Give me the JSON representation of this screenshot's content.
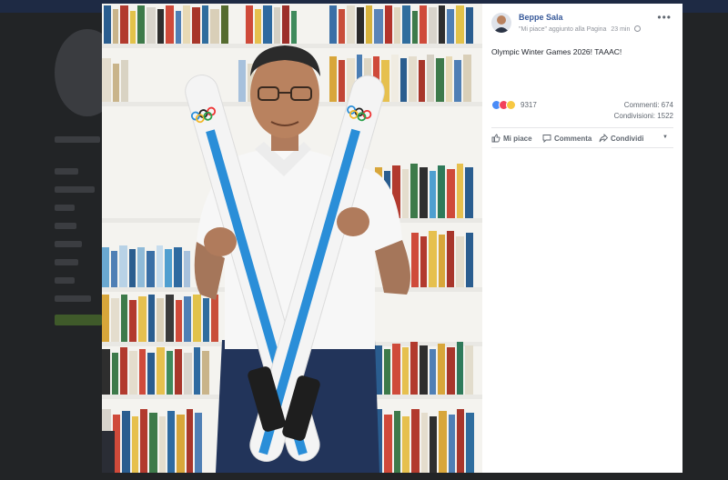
{
  "post": {
    "author": "Beppe Sala",
    "subtitle": "\"Mi piace\" aggiunto alla Pagina",
    "time": "23 min",
    "text": "Olympic Winter Games 2026! TAAAC!",
    "reactions_count": "9317",
    "comments": "Commenti: 674",
    "shares": "Condivisioni: 1522"
  },
  "actions": {
    "like": "Mi piace",
    "comment": "Commenta",
    "share": "Condividi"
  },
  "icons": {
    "more": "more-options-icon",
    "globe": "globe-icon",
    "like": "thumbs-up-icon",
    "comment": "comment-icon",
    "share": "share-icon",
    "menu": "chevron-down-icon"
  },
  "colors": {
    "author_link": "#365899",
    "ski_stripe": "#2a8ed8",
    "shirt": "#f7f7f7",
    "trousers": "#22345a"
  }
}
